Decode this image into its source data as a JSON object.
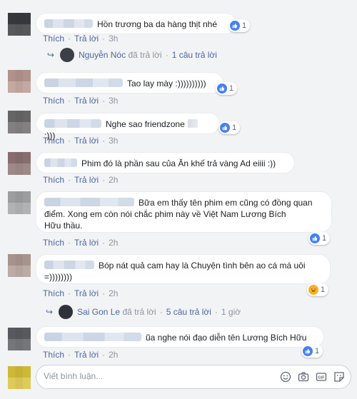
{
  "comments": [
    {
      "text": "Hồn trương ba da hàng thịt nhé",
      "like_label": "Thích",
      "reply_label": "Trả lời",
      "time": "3h",
      "reaction_count": "1",
      "reply_summary": {
        "name": "Nguyễn Nóc",
        "action": "đã trả lời",
        "count": "1 câu trả lời"
      }
    },
    {
      "text": "Tao lay mày :))))))))))",
      "like_label": "Thích",
      "reply_label": "Trả lời",
      "time": "3h",
      "reaction_count": "1"
    },
    {
      "text": "Nghe sao friendzone",
      "text_tail": ":)))",
      "like_label": "Thích",
      "reply_label": "Trả lời",
      "time": "3h",
      "reaction_count": "1"
    },
    {
      "text": "Phim đó là phần sau của Ăn khế trả vàng Ad eiiii :))",
      "like_label": "Thích",
      "reply_label": "Trả lời",
      "time": "2h"
    },
    {
      "text_line1": "Bữa em thấy tên phim em cũng có đồng quan",
      "text_line2": "điểm. Xong em còn nói chắc phim này về Việt Nam Lương Bích",
      "text_line3": "Hữu thầu.",
      "like_label": "Thích",
      "reply_label": "Trả lời",
      "time": "2h",
      "reaction_count": "1"
    },
    {
      "text_line1": "Bóp nát quả cam hay là Chuyện tình bên ao cá má uôi",
      "text_line2": "=))))))))",
      "like_label": "Thích",
      "reply_label": "Trả lời",
      "time": "2h",
      "reaction_count": "1",
      "reply_summary": {
        "name": "Sai Gon Le",
        "action": "đã trả lời",
        "count": "5 câu trả lời",
        "time": "1 giờ"
      }
    },
    {
      "text": "ũa nghe nói đạo diễn tên Lương Bích Hữu",
      "like_label": "Thích",
      "reply_label": "Trả lời",
      "time": "2h",
      "reaction_count": "1"
    }
  ],
  "composer": {
    "placeholder": "Viết bình luận..."
  },
  "icons": {
    "like": "like-icon",
    "haha": "haha-icon",
    "emoji": "emoji-icon",
    "camera": "camera-icon",
    "gif": "gif-icon",
    "sticker": "sticker-icon",
    "reply_arrow": "reply-arrow-icon"
  },
  "colors": {
    "link": "#4b67a1",
    "like_blue": "#4680f5",
    "haha_yellow": "#f7b125",
    "background": "#f2f3f5"
  }
}
